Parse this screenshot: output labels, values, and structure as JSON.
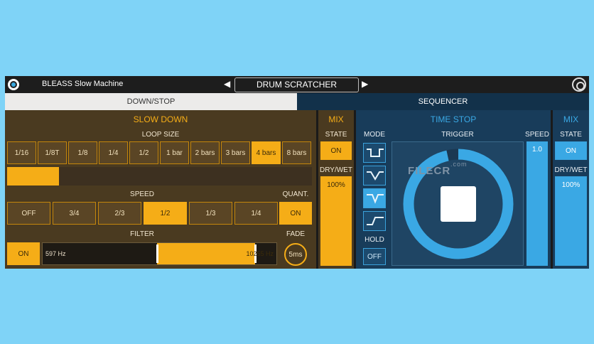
{
  "header": {
    "app_name": "BLEASS Slow Machine",
    "preset_name": "DRUM SCRATCHER",
    "prev_arrow": "◀",
    "next_arrow": "▶"
  },
  "tabs": {
    "left": "DOWN/STOP",
    "right": "SEQUENCER"
  },
  "slow_down": {
    "title": "SLOW DOWN",
    "loop_size_label": "LOOP SIZE",
    "loop_sizes": [
      "1/16",
      "1/8T",
      "1/8",
      "1/4",
      "1/2",
      "1 bar",
      "2 bars",
      "3 bars",
      "4 bars",
      "8 bars"
    ],
    "loop_selected": "4 bars",
    "loop_progress_percent": 17,
    "speed_label": "SPEED",
    "speeds": [
      "OFF",
      "3/4",
      "2/3",
      "1/2",
      "1/3",
      "1/4"
    ],
    "speed_selected": "1/2",
    "quant_label": "QUANT.",
    "quant_value": "ON",
    "filter_label": "FILTER",
    "filter_state": "ON",
    "filter_low": "597 Hz",
    "filter_high": "10255 Hz",
    "fade_label": "FADE",
    "fade_value": "5ms"
  },
  "mix_left": {
    "title": "MIX",
    "state_label": "STATE",
    "state_value": "ON",
    "dry_wet_label": "DRY/WET",
    "dry_wet_value": "100%"
  },
  "time_stop": {
    "title": "TIME STOP",
    "mode_label": "MODE",
    "trigger_label": "TRIGGER",
    "speed_label": "SPEED",
    "speed_value": "1.0",
    "hold_label": "HOLD",
    "hold_value": "OFF",
    "mode_icons": [
      "mode-shape-1-icon",
      "mode-shape-2-icon",
      "mode-shape-3-icon",
      "mode-shape-4-icon"
    ],
    "mode_selected_index": 2
  },
  "mix_right": {
    "title": "MIX",
    "state_label": "STATE",
    "state_value": "ON",
    "dry_wet_label": "DRY/WET",
    "dry_wet_value": "100%"
  },
  "watermark": {
    "text": "FILECR",
    "domain": ".com"
  },
  "colors": {
    "orange": "#f5ad17",
    "blue": "#3aa8e4",
    "background": "#7fd3f7"
  }
}
